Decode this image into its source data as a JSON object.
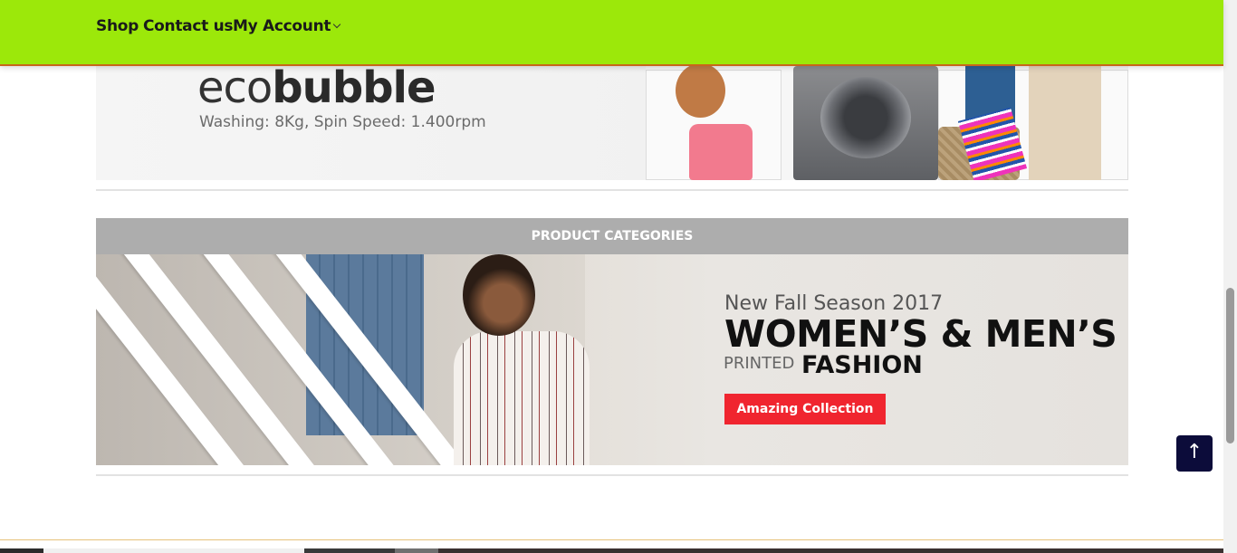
{
  "nav": {
    "shop": "Shop",
    "contact": "Contact us",
    "account": "My Account"
  },
  "top_banner": {
    "title_light": "eco",
    "title_bold": "bubble",
    "subtitle": "Washing: 8Kg, Spin Speed: 1.400rpm"
  },
  "categories": {
    "header": "PRODUCT CATEGORIES"
  },
  "fashion_banner": {
    "season": "New Fall Season 2017",
    "title": "WOMEN’S & MEN’S",
    "printed": "PRINTED",
    "fashion": "FASHION",
    "button": "Amazing Collection"
  },
  "scroll_top_icon": "arrow-up-icon",
  "colors": {
    "nav_bg": "#9ce80a",
    "nav_border": "#c8661b",
    "category_header_bg": "#adadad",
    "cta_red": "#f0252f",
    "scroll_button_bg": "#0c0c3a"
  }
}
